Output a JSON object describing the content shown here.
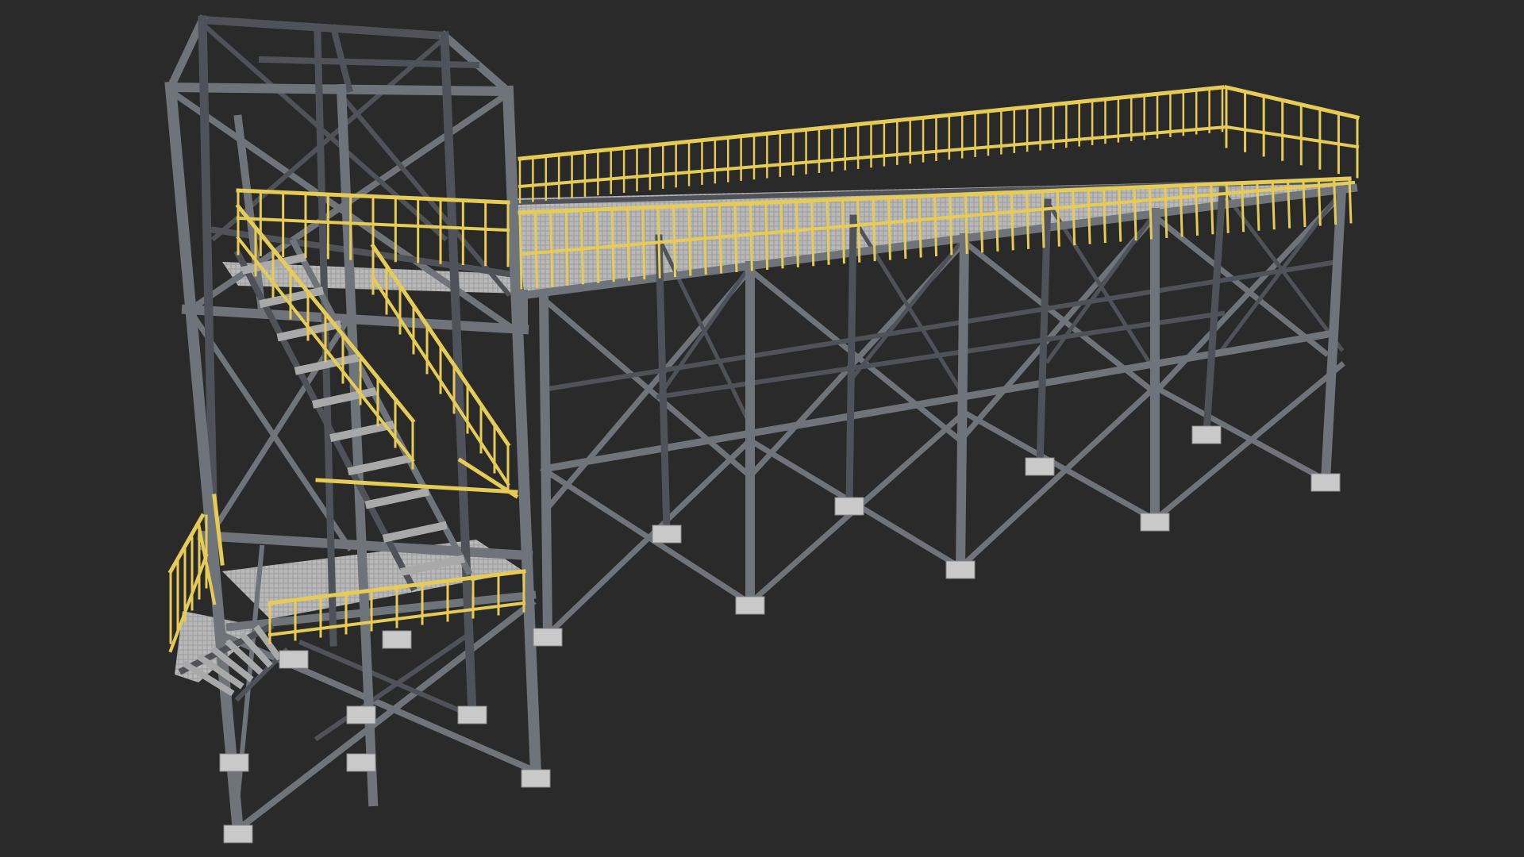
{
  "scene": {
    "subject": "steel-structure-3d-render",
    "background_color": "#2a2a2a",
    "steel_color": "#6f747b",
    "steel_dark": "#4f5359",
    "railing_color": "#e6cc55",
    "grating_color": "#bdbdbd",
    "base_color": "#c9c9c9"
  }
}
